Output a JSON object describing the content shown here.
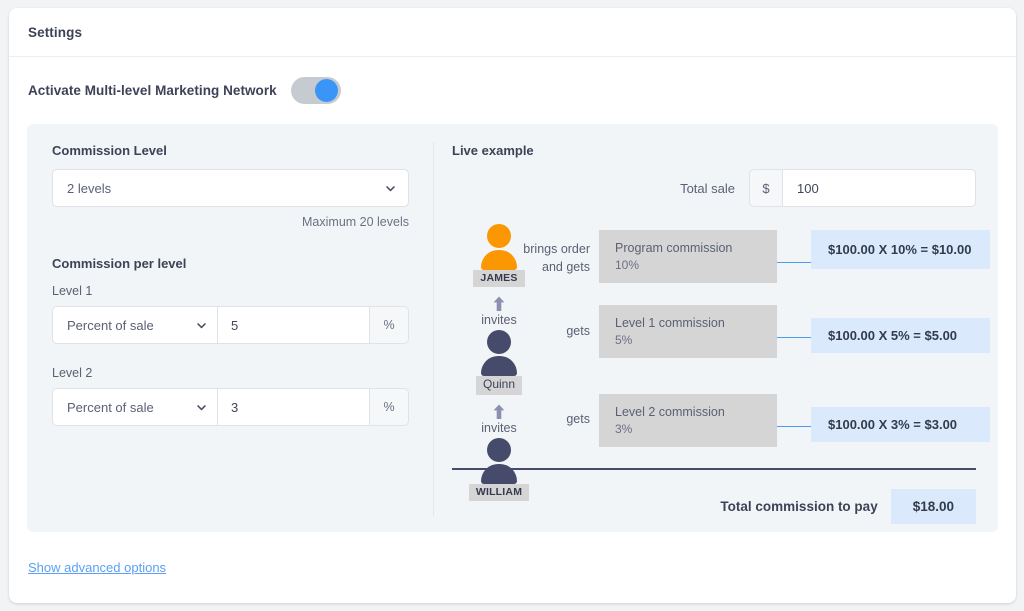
{
  "card": {
    "title": "Settings"
  },
  "activate": {
    "label": "Activate Multi-level Marketing Network",
    "toggle_state": "on",
    "accent_color": "#3b95f6",
    "track_color": "#c6cad1"
  },
  "commission_level": {
    "section_label": "Commission Level",
    "selected": "2 levels",
    "helper": "Maximum 20 levels"
  },
  "commission_per_level": {
    "section_label": "Commission per level",
    "levels": [
      {
        "label": "Level 1",
        "type_selected": "Percent of sale",
        "value": "5",
        "suffix": "%"
      },
      {
        "label": "Level 2",
        "type_selected": "Percent of sale",
        "value": "3",
        "suffix": "%"
      }
    ]
  },
  "live_example": {
    "section_label": "Live example",
    "total_sale": {
      "label": "Total sale",
      "currency_prefix": "$",
      "value": "100"
    },
    "people": [
      {
        "name": "JAMES",
        "style": "orange",
        "verb": "brings order and gets"
      },
      {
        "name": "Quinn",
        "style": "dark",
        "verb": "gets"
      },
      {
        "name": "WILLIAM",
        "style": "dark",
        "verb": "gets"
      }
    ],
    "connector_labels": [
      "invites",
      "invites"
    ],
    "rows": [
      {
        "commission_name": "Program commission",
        "commission_rate": "10%",
        "calculation": "$100.00 X 10% = $10.00"
      },
      {
        "commission_name": "Level 1 commission",
        "commission_rate": "5%",
        "calculation": "$100.00 X 5% = $5.00"
      },
      {
        "commission_name": "Level 2 commission",
        "commission_rate": "3%",
        "calculation": "$100.00 X 3% = $3.00"
      }
    ],
    "total": {
      "label": "Total commission to pay",
      "value": "$18.00"
    },
    "colors": {
      "gray_box": "#d5d5d5",
      "blue_box": "#daeafc",
      "connector": "#4b9bf0",
      "avatar_orange": "#fb9703",
      "avatar_dark": "#474b6b"
    }
  },
  "footer": {
    "advanced_link": "Show advanced options"
  }
}
